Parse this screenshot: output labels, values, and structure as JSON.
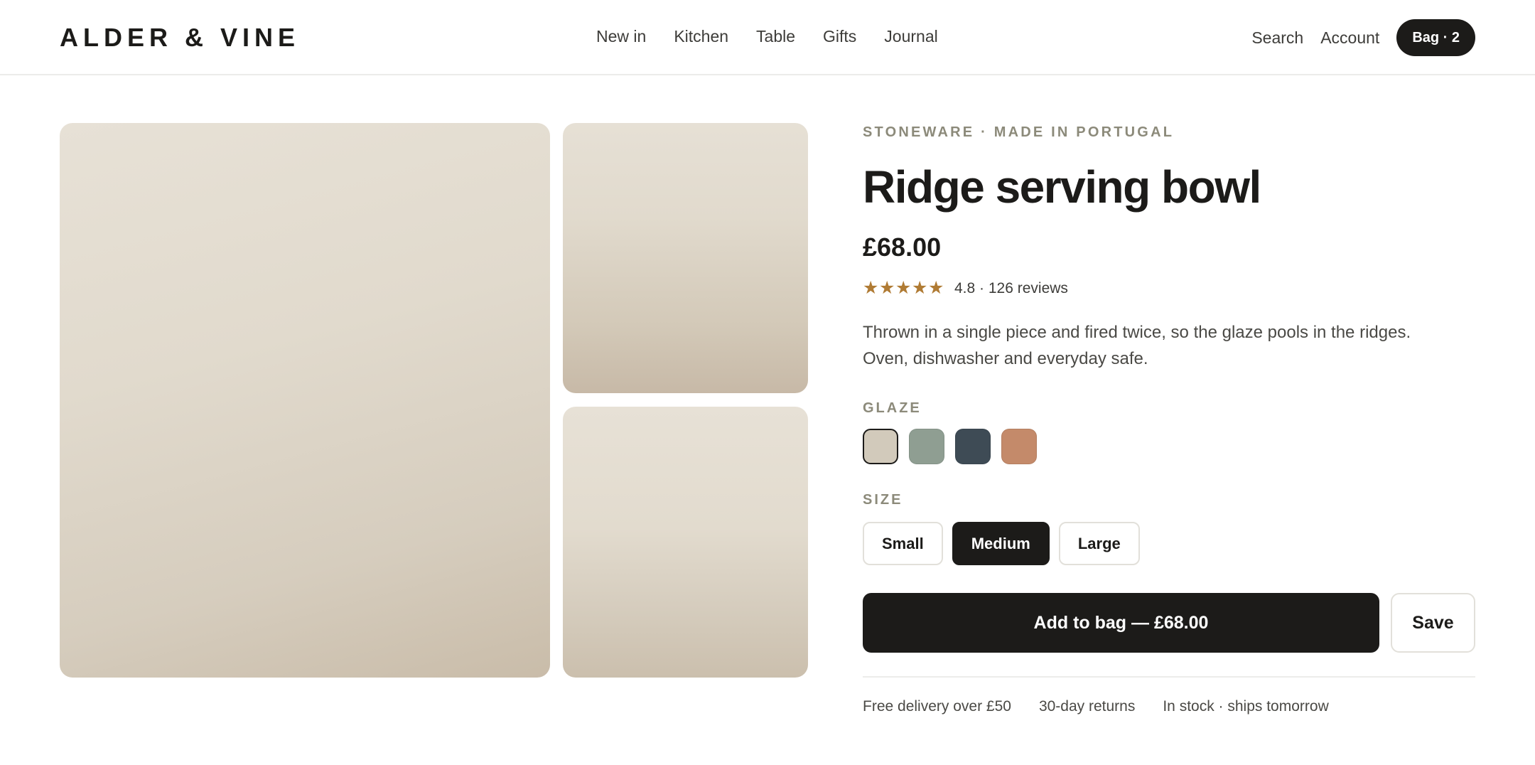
{
  "header": {
    "logo": "ALDER & VINE",
    "nav": [
      "New in",
      "Kitchen",
      "Table",
      "Gifts",
      "Journal"
    ],
    "search_label": "Search",
    "account_label": "Account",
    "bag_label": "Bag · 2"
  },
  "product": {
    "eyebrow": "STONEWARE · MADE IN PORTUGAL",
    "title": "Ridge serving bowl",
    "price": "£68.00",
    "rating": {
      "stars": 5,
      "star_glyph": "★",
      "star_color": "#b07b34",
      "text": "4.8 · 126 reviews"
    },
    "description": "Thrown in a single piece and fired twice, so the glaze pools in the ridges. Oven, dishwasher and everyday safe.",
    "glaze": {
      "label": "GLAZE",
      "swatches": [
        {
          "color": "#d2cabb",
          "selected": true
        },
        {
          "color": "#8f9e92",
          "selected": false
        },
        {
          "color": "#3e4b55",
          "selected": false
        },
        {
          "color": "#c48a6a",
          "selected": false
        }
      ]
    },
    "size": {
      "label": "SIZE",
      "options": [
        "Small",
        "Medium",
        "Large"
      ],
      "selected": "Medium"
    },
    "add_to_bag_label": "Add to bag — £68.00",
    "save_label": "Save",
    "perks": [
      "Free delivery over £50",
      "30-day returns",
      "In stock · ships tomorrow"
    ]
  },
  "colors": {
    "accent": "#1c1b19",
    "muted_label": "#8c8a7a",
    "image_placeholder": "#e1dacd"
  }
}
